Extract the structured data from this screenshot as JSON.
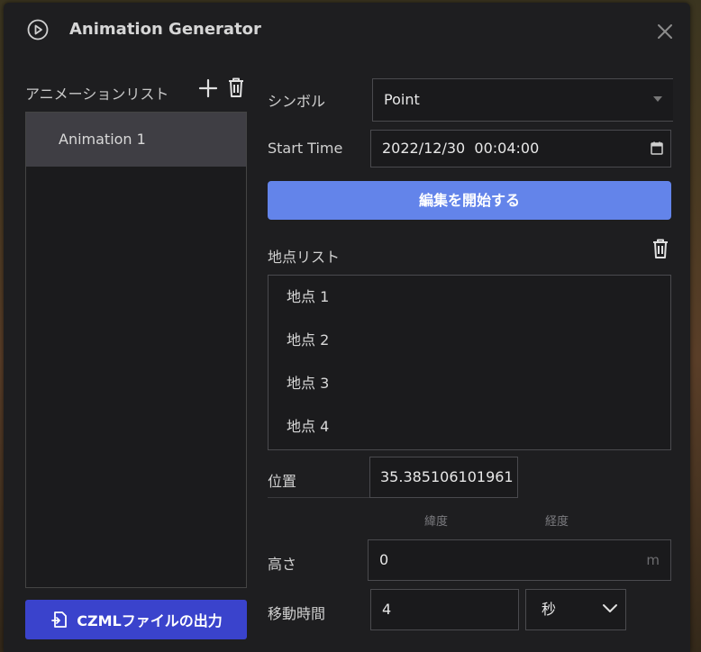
{
  "window": {
    "title": "Animation Generator"
  },
  "animation_list": {
    "label": "アニメーションリスト",
    "items": [
      "Animation 1"
    ],
    "selected_index": 0
  },
  "form": {
    "symbol_label": "シンボル",
    "symbol_value": "Point",
    "start_time_label": "Start Time",
    "start_time_value": "2022/12/30  00:04:00",
    "edit_button": "編集を開始する",
    "points_label": "地点リスト",
    "points": [
      "地点 1",
      "地点 2",
      "地点 3",
      "地点 4"
    ],
    "position_label": "位置",
    "position_value": "35.385106101961",
    "latitude_label": "緯度",
    "longitude_label": "経度",
    "height_label": "高さ",
    "height_value": "0",
    "height_unit": "m",
    "duration_label": "移動時間",
    "duration_value": "4",
    "duration_unit": "秒"
  },
  "export_button": "CZMLファイルの出力",
  "colors": {
    "panel_bg": "#1e1e20",
    "primary_button": "#6384ea",
    "export_button": "#3a43cc",
    "selected_item": "#3f3e44"
  },
  "icons": {
    "header": "play-circle-icon",
    "close": "close-icon",
    "add": "plus-icon",
    "delete": "trash-icon",
    "calendar": "calendar-icon",
    "export": "export-file-icon",
    "dropdown": "chevron-down-icon"
  }
}
